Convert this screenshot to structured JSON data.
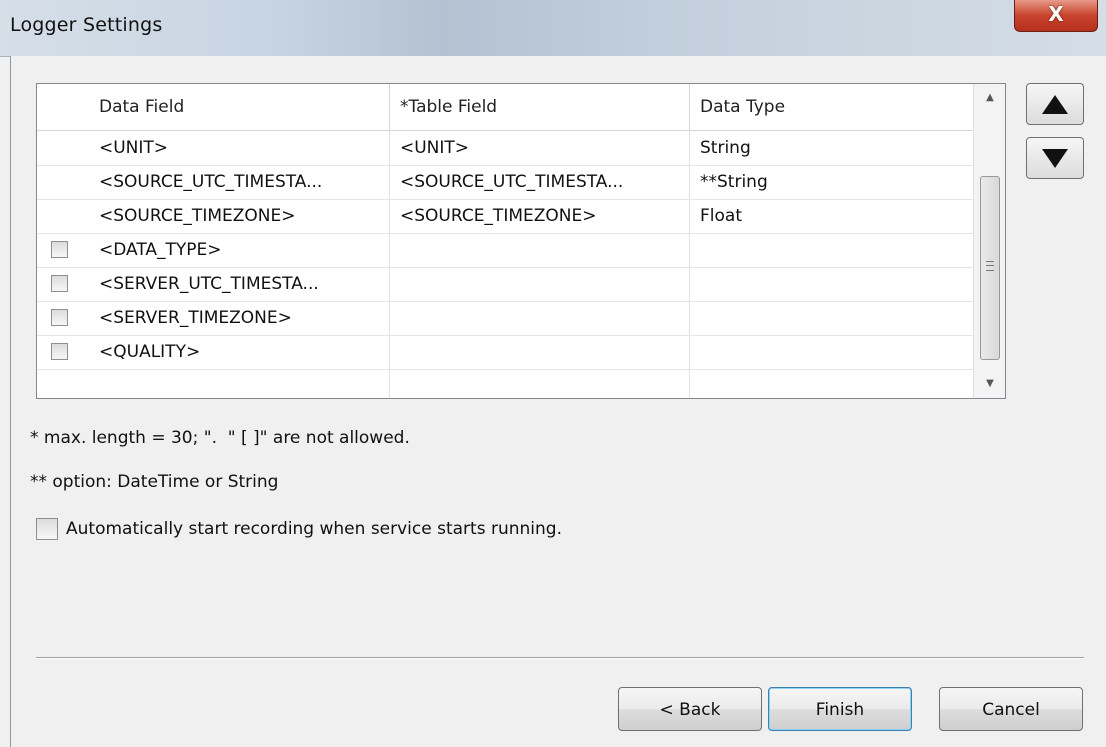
{
  "window": {
    "title": "Logger Settings",
    "close_glyph": "X"
  },
  "grid": {
    "columns": [
      "Data Field",
      "*Table Field",
      "Data Type"
    ],
    "rows": [
      {
        "checkbox": false,
        "data_field": "<UNIT>",
        "table_field": "<UNIT>",
        "data_type": "String"
      },
      {
        "checkbox": false,
        "data_field": "<SOURCE_UTC_TIMESTA...",
        "table_field": "<SOURCE_UTC_TIMESTA...",
        "data_type": "**String"
      },
      {
        "checkbox": false,
        "data_field": "<SOURCE_TIMEZONE>",
        "table_field": "<SOURCE_TIMEZONE>",
        "data_type": "Float"
      },
      {
        "checkbox": true,
        "data_field": "<DATA_TYPE>",
        "table_field": "",
        "data_type": ""
      },
      {
        "checkbox": true,
        "data_field": "<SERVER_UTC_TIMESTA...",
        "table_field": "",
        "data_type": ""
      },
      {
        "checkbox": true,
        "data_field": "<SERVER_TIMEZONE>",
        "table_field": "",
        "data_type": ""
      },
      {
        "checkbox": true,
        "data_field": "<QUALITY>",
        "table_field": "",
        "data_type": ""
      }
    ],
    "scroll_up_glyph": "▲",
    "scroll_down_glyph": "▼"
  },
  "notes": {
    "max_length": "* max. length = 30; \".  \" [ ]\" are not allowed.",
    "option": "** option: DateTime or String"
  },
  "auto_start": {
    "label": "Automatically start recording when service starts running.",
    "checked": false
  },
  "buttons": {
    "back": "< Back",
    "finish": "Finish",
    "cancel": "Cancel"
  },
  "icons": {
    "move_up": "up-triangle-icon",
    "move_down": "down-triangle-icon"
  }
}
